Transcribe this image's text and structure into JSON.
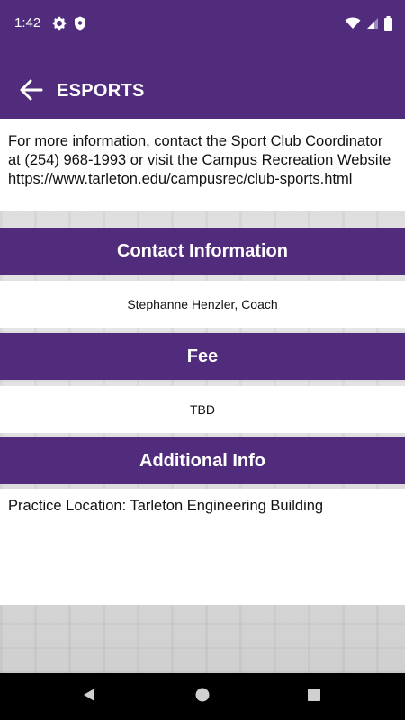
{
  "status_bar": {
    "time": "1:42",
    "icons_left": [
      "gear-icon",
      "shield-icon"
    ],
    "icons_right": [
      "wifi-icon",
      "cellular-signal-icon",
      "battery-icon"
    ]
  },
  "app_bar": {
    "back_icon": "arrow-left-icon",
    "title": "ESPORTS"
  },
  "info": {
    "text": "For more information, contact the Sport Club Coordinator at (254) 968-1993 or visit the Campus Recreation Website https://www.tarleton.edu/campusrec/club-sports.html"
  },
  "sections": {
    "contact": {
      "header": "Contact Information",
      "value": "Stephanne Henzler, Coach"
    },
    "fee": {
      "header": "Fee",
      "value": "TBD"
    },
    "additional": {
      "header": "Additional Info",
      "value": "Practice Location: Tarleton Engineering Building"
    }
  },
  "nav_bar": {
    "buttons": [
      "back-triangle-icon",
      "home-circle-icon",
      "recents-square-icon"
    ]
  },
  "colors": {
    "primary": "#512c7d",
    "surface": "#ffffff",
    "nav_background": "#000000"
  }
}
